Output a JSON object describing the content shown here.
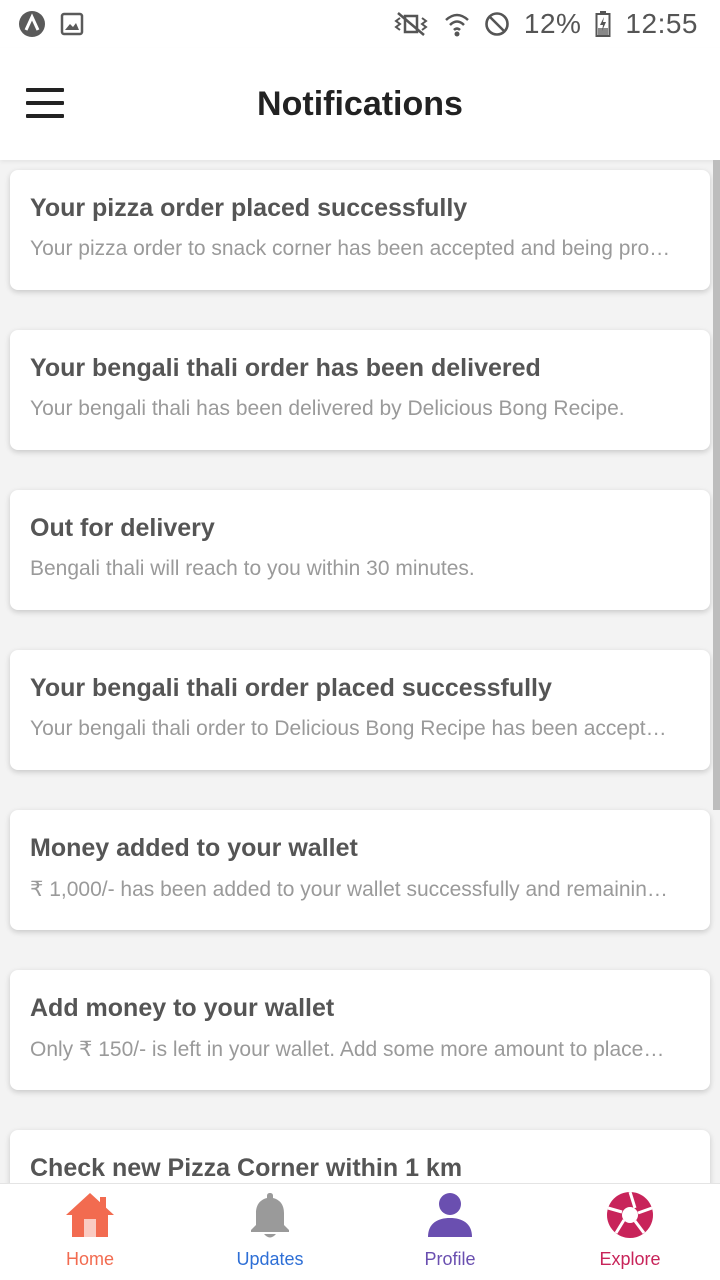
{
  "status_bar": {
    "battery": "12%",
    "time": "12:55"
  },
  "header": {
    "title": "Notifications"
  },
  "notifications": [
    {
      "title": "Your pizza order placed successfully",
      "body": "Your pizza order to snack corner has been accepted and being pro…"
    },
    {
      "title": "Your bengali thali order has been delivered",
      "body": "Your bengali thali has been delivered by Delicious Bong Recipe."
    },
    {
      "title": "Out for delivery",
      "body": "Bengali thali will reach to you within 30 minutes."
    },
    {
      "title": "Your bengali thali order placed successfully",
      "body": "Your bengali thali order to Delicious Bong Recipe has been accept…"
    },
    {
      "title": "Money added to your wallet",
      "body": "₹ 1,000/- has been added to your wallet successfully and remainin…"
    },
    {
      "title": "Add money to your wallet",
      "body": "Only ₹ 150/- is left in your wallet. Add some more amount to place…"
    },
    {
      "title": "Check new Pizza Corner within 1 km",
      "body": ""
    }
  ],
  "bottom_nav": [
    {
      "label": "Home",
      "icon": "home-icon",
      "color": "#f26b50"
    },
    {
      "label": "Updates",
      "icon": "bell-icon",
      "color": "#2e6fd6"
    },
    {
      "label": "Profile",
      "icon": "person-icon",
      "color": "#6a4fb0"
    },
    {
      "label": "Explore",
      "icon": "aperture-icon",
      "color": "#c8245a"
    }
  ]
}
